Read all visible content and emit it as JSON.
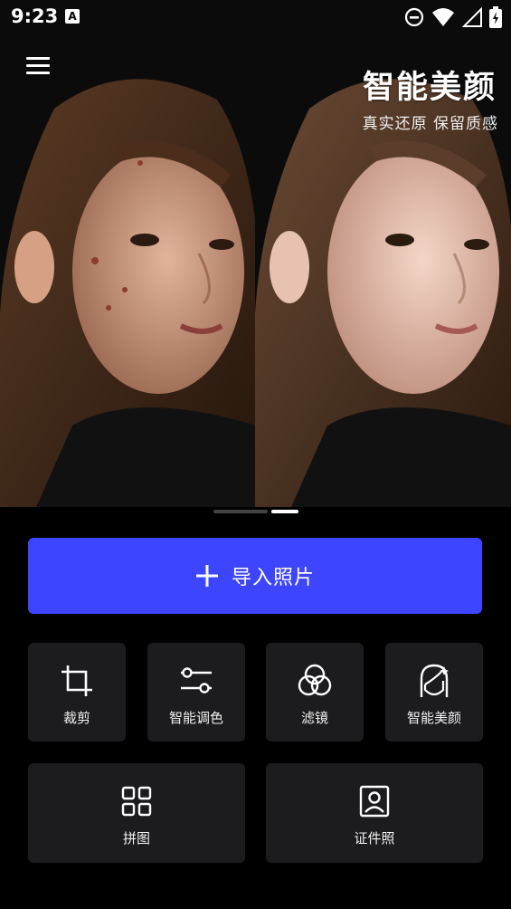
{
  "status_bar": {
    "time": "9:23",
    "notification_icon": "text-a-icon"
  },
  "hero": {
    "title": "智能美颜",
    "subtitle": "真实还原  保留质感",
    "slides": 2,
    "active_slide": 1
  },
  "import": {
    "label": "导入照片",
    "icon": "plus-icon",
    "color": "#3e45ff"
  },
  "tools": [
    {
      "label": "裁剪",
      "icon": "crop-icon"
    },
    {
      "label": "智能调色",
      "icon": "sliders-icon"
    },
    {
      "label": "滤镜",
      "icon": "filter-circles-icon"
    },
    {
      "label": "智能美颜",
      "icon": "face-icon"
    }
  ],
  "tools_bottom": [
    {
      "label": "拼图",
      "icon": "grid-icon"
    },
    {
      "label": "证件照",
      "icon": "id-photo-icon"
    }
  ]
}
